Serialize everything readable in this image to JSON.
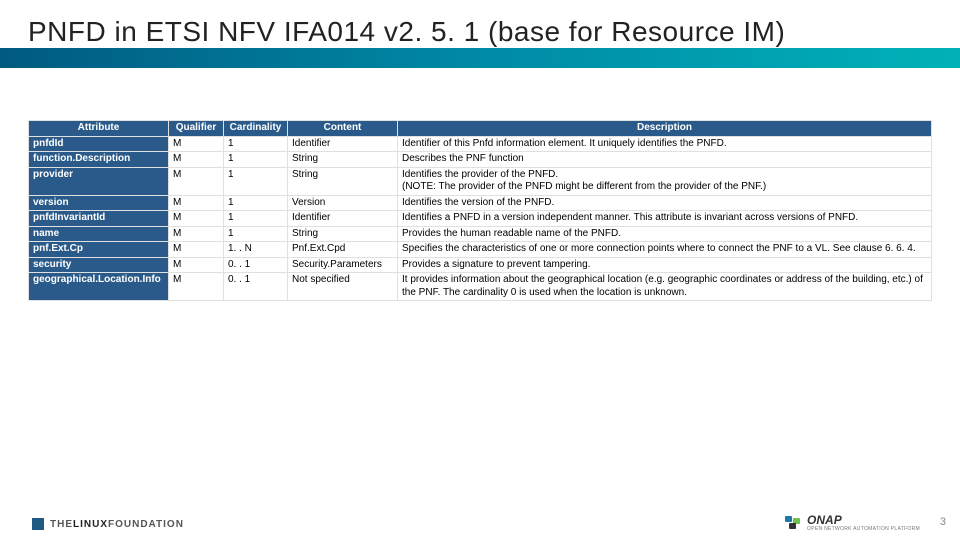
{
  "title": "PNFD in ETSI NFV IFA014 v2. 5. 1 (base for Resource IM)",
  "headers": [
    "Attribute",
    "Qualifier",
    "Cardinality",
    "Content",
    "Description"
  ],
  "rows": [
    {
      "attr": "pnfdId",
      "qual": "M",
      "card": "1",
      "cont": "Identifier",
      "desc": "Identifier of this Pnfd information element. It uniquely identifies the PNFD."
    },
    {
      "attr": "function.Description",
      "qual": "M",
      "card": "1",
      "cont": "String",
      "desc": "Describes the PNF function"
    },
    {
      "attr": "provider",
      "qual": "M",
      "card": "1",
      "cont": "String",
      "desc": "Identifies the provider of the PNFD.\n(NOTE: The provider of the PNFD might be different from the provider of the PNF.)"
    },
    {
      "attr": "version",
      "qual": "M",
      "card": "1",
      "cont": "Version",
      "desc": "Identifies the version of the PNFD."
    },
    {
      "attr": "pnfdInvariantId",
      "qual": "M",
      "card": "1",
      "cont": "Identifier",
      "desc": "Identifies a PNFD in a version independent manner. This attribute is invariant across versions of PNFD."
    },
    {
      "attr": "name",
      "qual": "M",
      "card": "1",
      "cont": "String",
      "desc": "Provides the human readable name of the PNFD."
    },
    {
      "attr": "pnf.Ext.Cp",
      "qual": "M",
      "card": "1. . N",
      "cont": "Pnf.Ext.Cpd",
      "desc": "Specifies the characteristics of one or more connection points where to connect the PNF to a VL. See clause 6. 6. 4."
    },
    {
      "attr": "security",
      "qual": "M",
      "card": "0. . 1",
      "cont": "Security.Parameters",
      "desc": "Provides a signature to prevent tampering."
    },
    {
      "attr": "geographical.Location.Info",
      "qual": "M",
      "card": "0. . 1",
      "cont": "Not specified",
      "desc": "It provides information about the geographical location (e.g. geographic coordinates or address of the building, etc.) of the PNF. The cardinality 0 is used when the location is unknown."
    }
  ],
  "footer": {
    "linux_foundation_prefix": "THE",
    "linux_foundation_main": "LINUX",
    "linux_foundation_suffix": "FOUNDATION",
    "onap_label": "ONAP",
    "onap_sub": "OPEN NETWORK AUTOMATION PLATFORM",
    "page": "3"
  }
}
